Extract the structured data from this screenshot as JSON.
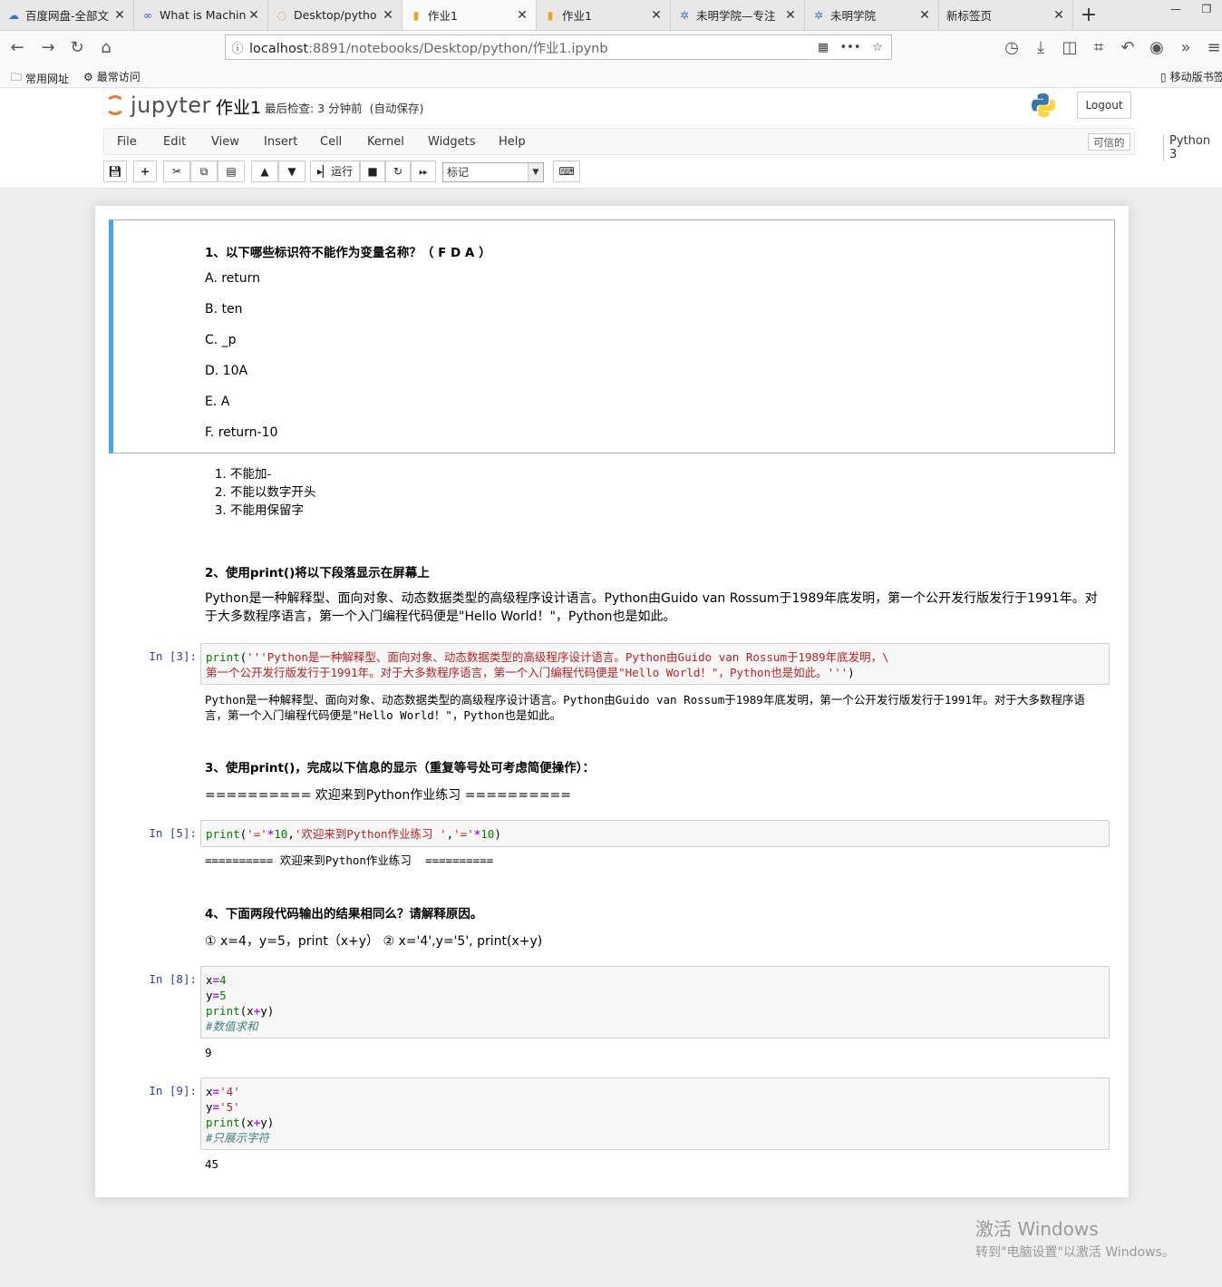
{
  "browser": {
    "tabs": [
      {
        "title": "百度网盘-全部文",
        "icon": "cloud-icon",
        "active": false
      },
      {
        "title": "What is Machin",
        "icon": "infinity-icon",
        "active": false
      },
      {
        "title": "Desktop/pytho",
        "icon": "jupyter-icon",
        "active": false
      },
      {
        "title": "作业1",
        "icon": "notebook-icon",
        "active": true
      },
      {
        "title": "作业1",
        "icon": "notebook-icon",
        "active": false
      },
      {
        "title": "未明学院—专注",
        "icon": "logo-icon",
        "active": false
      },
      {
        "title": "未明学院",
        "icon": "logo-icon",
        "active": false
      },
      {
        "title": "新标签页",
        "icon": "",
        "active": false
      }
    ],
    "url_host": "localhost",
    "url_rest": ":8891/notebooks/Desktop/python/作业1.ipynb",
    "bookmarks": [
      "常用网址",
      "最常访问",
      "移动版书签"
    ]
  },
  "jupyter": {
    "logo_text": "jupyter",
    "notebook_name": "作业1",
    "checkpoint": "最后检查: 3 分钟前",
    "autosave": "(自动保存)",
    "logout": "Logout",
    "menu": [
      "File",
      "Edit",
      "View",
      "Insert",
      "Cell",
      "Kernel",
      "Widgets",
      "Help"
    ],
    "trusted": "可信的",
    "kernel": "Python 3",
    "run_label": "运行",
    "cell_type": "标记",
    "accent": "#42a5f5",
    "logo_color": "#f37726"
  },
  "cells": {
    "q1": {
      "title": "1、以下哪些标识符不能作为变量名称？（ F D A ）",
      "options": [
        "A. return",
        "B. ten",
        "C. _p",
        "D. 10A",
        "E. A",
        "F. return-10"
      ],
      "rules": [
        "不能加-",
        "不能以数字开头",
        "不能用保留字"
      ]
    },
    "q2": {
      "title": "2、使用print()将以下段落显示在屏幕上",
      "para": "Python是一种解释型、面向对象、动态数据类型的高级程序设计语言。Python由Guido van Rossum于1989年底发明，第一个公开发行版发行于1991年。对于大多数程序语言，第一个入门编程代码便是\"Hello World！\"，Python也是如此。",
      "prompt": "In  [3]:",
      "code_line1": "'''Python是一种解释型、面向对象、动态数据类型的高级程序设计语言。Python由Guido van Rossum于1989年底发明，\\",
      "code_line2": "第一个公开发行版发行于1991年。对于大多数程序语言，第一个入门编程代码便是\"Hello World！\"，Python也是如此。'''",
      "output": "Python是一种解释型、面向对象、动态数据类型的高级程序设计语言。Python由Guido van Rossum于1989年底发明，第一个公开发行版发行于1991年。对于大多数程序语言，第一个入门编程代码便是\"Hello World！\"，Python也是如此。"
    },
    "q3": {
      "title": "3、使用print()，完成以下信息的显示（重复等号处可考虑简便操作）：",
      "para": "========== 欢迎来到Python作业练习 ==========",
      "prompt": "In  [5]:",
      "code_s1": "'='",
      "code_n1": "10",
      "code_s2": "'欢迎来到Python作业练习 '",
      "code_s3": "'='",
      "code_n2": "10",
      "output": "========== 欢迎来到Python作业练习  =========="
    },
    "q4": {
      "title": "4、下面两段代码输出的结果相同么？请解释原因。",
      "para": "① x=4，y=5，print（x+y） ② x='4',y='5', print(x+y)",
      "cell1": {
        "prompt": "In  [8]:",
        "x": "4",
        "y": "5",
        "comment": "#数值求和",
        "output": "9"
      },
      "cell2": {
        "prompt": "In  [9]:",
        "x": "'4'",
        "y": "'5'",
        "comment": "#只展示字符",
        "output": "45"
      }
    }
  },
  "watermark": {
    "line1": "激活 Windows",
    "line2": "转到\"电脑设置\"以激活 Windows。"
  }
}
